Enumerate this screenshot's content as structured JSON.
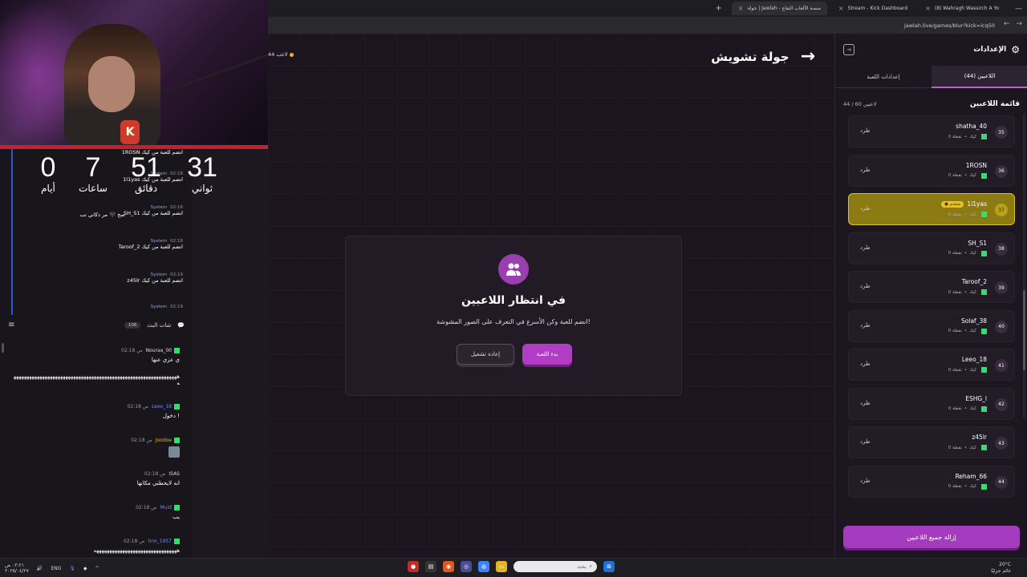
{
  "browser": {
    "tabs": [
      {
        "label": "(8) Wahragh Wassirch A Yo",
        "active": false
      },
      {
        "label": "Stream - Kick Dashboard",
        "active": false
      },
      {
        "label": "جولة | Jawlah - منصة الألعاب التفاع",
        "active": true
      }
    ],
    "url": "jawlah.live/games/blur?kick=icq50"
  },
  "stream_overlay": {
    "countdown": [
      {
        "value": "31",
        "label": "ثواني"
      },
      {
        "value": "51",
        "label": "دقائق"
      },
      {
        "value": "7",
        "label": "ساعات"
      },
      {
        "value": "0",
        "label": "أيام"
      }
    ],
    "events": [
      {
        "meta": "System",
        "time": "",
        "text": "1ROSN انضم للعبة من كيك"
      },
      {
        "meta": "System",
        "time": "02:18",
        "text": "1l1yas انضم للعبة من كيك"
      },
      {
        "meta": "System",
        "time": "02:18",
        "text": "SH_S1 انضم للعبة من كيك"
      },
      {
        "meta": "System",
        "time": "02:18",
        "text": "Taroof_2 انضم للعبة من كيك"
      },
      {
        "meta": "System",
        "time": "02:19",
        "text": "z45lr انضم للعبة من كيك"
      },
      {
        "meta": "System",
        "time": "02:19",
        "text": ""
      }
    ],
    "overlay_note": "صج 🖤 مر ذكاني تب",
    "chat_title": "شات البث",
    "chat_count": "106",
    "chat": [
      {
        "user": "Nouraa_00",
        "time": "02:18 ص",
        "user_color": "#dddddd",
        "text": "ي عزي عنها"
      },
      {
        "user": "",
        "time": "",
        "user_color": "#dddddd",
        "text": "ههههههههههههههههههههههههههههههههههههههههههههههههههههههههههههههههه"
      },
      {
        "user": "Leeo_18",
        "time": "02:18 ص",
        "user_color": "#6f8bf0",
        "text": "دخول !"
      },
      {
        "user": "Joodoe",
        "time": "02:18 ص",
        "user_color": "#f2b01e",
        "text": ""
      },
      {
        "user": "ISAS",
        "time": "02:18 ص",
        "user_color": "#dddddd",
        "text": "انه لايحطني مكانها"
      },
      {
        "user": "Muid",
        "time": "02:18 ص",
        "user_color": "#6f8bf0",
        "text": "يب"
      },
      {
        "user": "hno_1957",
        "time": "02:18 ص",
        "user_color": "#6f8bf0",
        "text": "ههههههههههههههههههههههههههههههههه"
      }
    ]
  },
  "game": {
    "players_indicator": "44 لاعب",
    "title": "جولة تشويش",
    "card": {
      "title": "في انتظار اللاعبين",
      "subtitle": "انضم للعبة وكن الأسرع في التعرف على الصور المشوشة!",
      "start_label": "بدء اللعبة",
      "reset_label": "إعادة تشغيل"
    }
  },
  "settings_panel": {
    "title": "الإعدادات",
    "tabs": [
      {
        "label": "اللاعبين (44)",
        "active": true
      },
      {
        "label": "إعدادات اللعبة",
        "active": false
      }
    ],
    "list_title": "قائمة اللاعبين",
    "list_count": "44 / 60 لاعبين",
    "kick_label": "طرد",
    "platform_label": "كيك",
    "points_label": "0 نقطة",
    "players": [
      {
        "num": "35",
        "name": "shatha_40",
        "tag": "",
        "highlight": false
      },
      {
        "num": "36",
        "name": "1ROSN",
        "tag": "",
        "highlight": false
      },
      {
        "num": "37",
        "name": "1l1yas",
        "tag": "● متقدم",
        "highlight": true
      },
      {
        "num": "38",
        "name": "SH_S1",
        "tag": "",
        "highlight": false
      },
      {
        "num": "39",
        "name": "Taroof_2",
        "tag": "",
        "highlight": false
      },
      {
        "num": "40",
        "name": "Solaf_38",
        "tag": "",
        "highlight": false
      },
      {
        "num": "41",
        "name": "Leeo_18",
        "tag": "",
        "highlight": false
      },
      {
        "num": "42",
        "name": "ESHG_l",
        "tag": "",
        "highlight": false
      },
      {
        "num": "43",
        "name": "z45lr",
        "tag": "",
        "highlight": false
      },
      {
        "num": "44",
        "name": "Reham_66",
        "tag": "",
        "highlight": false
      }
    ],
    "clear_all_label": "إزالة جميع اللاعبين"
  },
  "taskbar": {
    "lang": "ENG",
    "search_placeholder": "بحث",
    "time": "٠٢:٢١ ص",
    "date": "٢٠٢٥/٠٤/٢٧",
    "weather": "20°C",
    "weather_desc": "غائم جزئيًا"
  },
  "colors": {
    "accent": "#b03dc4",
    "highlight": "#8c7a12",
    "kick_green": "#2fe06a"
  }
}
